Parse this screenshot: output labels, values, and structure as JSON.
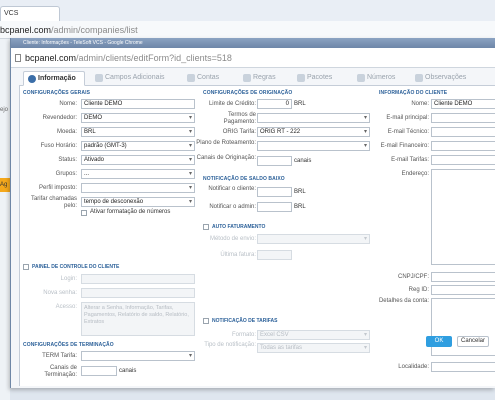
{
  "bg": {
    "tab_label": "VCS",
    "url_host": "bcpanel.com",
    "url_path": "/admin/companies/list",
    "side_label": "ejo",
    "side_badge": "Ag"
  },
  "popup": {
    "title": "Cliente: Informações - TeleSoft VCS - Google Chrome",
    "url_host": "bcpanel.com",
    "url_path": "/admin/clients/editForm?id_clients=518"
  },
  "tabs": [
    {
      "label": "Informação"
    },
    {
      "label": "Campos Adicionais"
    },
    {
      "label": "Contas"
    },
    {
      "label": "Regras"
    },
    {
      "label": "Pacotes"
    },
    {
      "label": "Números"
    },
    {
      "label": "Observações"
    }
  ],
  "general": {
    "title": "CONFIGURAÇÕES GERAIS",
    "nome_label": "Nome:",
    "nome_value": "Cliente DEMO",
    "revendedor_label": "Revendedor:",
    "revendedor_value": "DEMO",
    "moeda_label": "Moeda:",
    "moeda_value": "BRL",
    "fuso_label": "Fuso Horário:",
    "fuso_value": "padrão (GMT-3)",
    "status_label": "Status:",
    "status_value": "Ativado",
    "grupos_label": "Grupos:",
    "grupos_value": "...",
    "perfil_label": "Perfil imposto:",
    "perfil_value": "",
    "tarifar_label": "Tarifar chamadas pelo:",
    "tarifar_value": "tempo de desconexão",
    "formatacao_label": "Ativar formatação de números"
  },
  "painel": {
    "title": "PAINEL DE CONTROLE DO CLIENTE",
    "login_label": "Login:",
    "senha_label": "Nova senha:",
    "acesso_label": "Acesso:",
    "acesso_value": "Alterar a Senha, Informação, Tarifas, Pagamentos, Relatório de saldo, Relatório, Extratos"
  },
  "terminacao": {
    "title": "CONFIGURAÇÕES DE TERMINAÇÃO",
    "term_label": "TERM Tarifa:",
    "term_value": "",
    "canais_label": "Canais de Terminação:",
    "canais_unit": "canais"
  },
  "originacao": {
    "title": "CONFIGURAÇÕES DE ORIGINAÇÃO",
    "limite_label": "Limite de Crédito:",
    "limite_value": "0",
    "limite_unit": "BRL",
    "termos_label": "Termos de Pagamento:",
    "orig_label": "ORIG Tarifa:",
    "orig_value": "ORIG RT - 222",
    "plano_label": "Plano de Roteamento:",
    "canais_label": "Canais de Originação:",
    "canais_unit": "canais"
  },
  "saldo": {
    "title": "NOTIFICAÇÃO DE SALDO BAIXO",
    "cliente_label": "Notificar o cliente:",
    "cliente_unit": "BRL",
    "admin_label": "Notificar o admin:",
    "admin_unit": "BRL"
  },
  "auto": {
    "title": "AUTO FATURAMENTO",
    "metodo_label": "Método de envio:",
    "ultima_label": "Última fatura:"
  },
  "tarifas": {
    "title": "NOTIFICAÇÃO DE TARIFAS",
    "formato_label": "Formato:",
    "formato_value": "Excel CSV",
    "tipo_label": "Tipo de notificação:",
    "tipo_value": "Todas as tarifas"
  },
  "cliente": {
    "title": "INFORMAÇÃO DO CLIENTE",
    "nome_label": "Nome:",
    "nome_value": "Cliente DEMO",
    "email_principal_label": "E-mail principal:",
    "email_tecnico_label": "E-mail Técnico:",
    "email_financeiro_label": "E-mail Financeiro:",
    "email_tarifas_label": "E-mail Tarifas:",
    "endereco_label": "Endereço:",
    "cnpj_label": "CNPJ/CPF:",
    "reg_label": "Reg ID:",
    "detalhes_label": "Detalhes da conta:",
    "localidade_label": "Localidade:"
  },
  "buttons": {
    "ok": "OK",
    "cancel": "Cancelar"
  }
}
